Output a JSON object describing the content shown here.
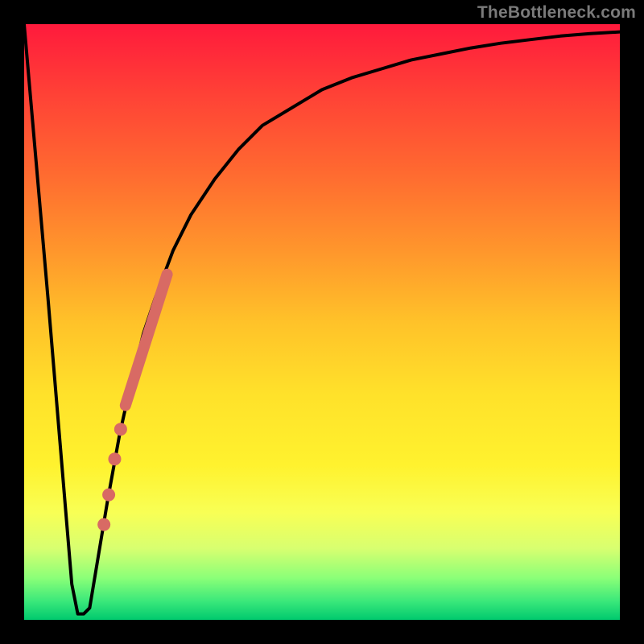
{
  "watermark": "TheBottleneck.com",
  "colors": {
    "background": "#000000",
    "curve": "#000000",
    "highlight": "#d86a64",
    "gradient_top": "#ff1a3c",
    "gradient_bottom": "#00c96e"
  },
  "chart_data": {
    "type": "line",
    "title": "",
    "xlabel": "",
    "ylabel": "",
    "xlim": [
      0,
      100
    ],
    "ylim": [
      0,
      100
    ],
    "grid": false,
    "legend": false,
    "series": [
      {
        "name": "bottleneck-curve",
        "x": [
          0,
          2,
          4,
          6,
          8,
          9,
          10,
          11,
          12,
          14,
          16,
          18,
          20,
          22,
          25,
          28,
          32,
          36,
          40,
          45,
          50,
          55,
          60,
          65,
          70,
          75,
          80,
          85,
          90,
          95,
          100
        ],
        "y": [
          100,
          77,
          54,
          30,
          6,
          1,
          1,
          2,
          8,
          20,
          31,
          40,
          48,
          54,
          62,
          68,
          74,
          79,
          83,
          86,
          89,
          91,
          92.5,
          94,
          95,
          96,
          96.8,
          97.4,
          98,
          98.4,
          98.7
        ]
      }
    ],
    "highlights": {
      "segment": {
        "x_start": 17,
        "x_end": 24,
        "y_start": 36,
        "y_end": 58
      },
      "dots": [
        {
          "x": 16.2,
          "y": 32
        },
        {
          "x": 15.2,
          "y": 27
        },
        {
          "x": 14.2,
          "y": 21
        },
        {
          "x": 13.4,
          "y": 16
        }
      ]
    }
  }
}
